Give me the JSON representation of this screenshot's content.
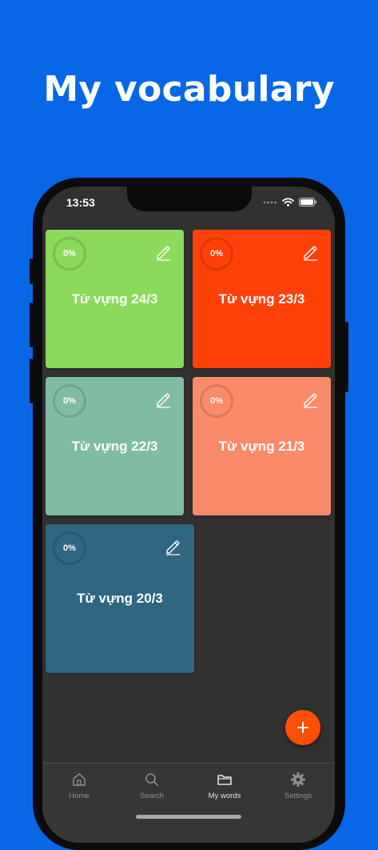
{
  "promo": {
    "title": "My vocabulary"
  },
  "status_bar": {
    "time": "13:53"
  },
  "cards": [
    {
      "title": "Từ vựng 24/3",
      "progress": "0%",
      "color": "#8BDA5C"
    },
    {
      "title": "Từ vựng 23/3",
      "progress": "0%",
      "color": "#FF4109"
    },
    {
      "title": "Từ vựng 22/3",
      "progress": "0%",
      "color": "#80BCA2"
    },
    {
      "title": "Từ vựng 21/3",
      "progress": "0%",
      "color": "#F98A6A"
    },
    {
      "title": "Từ vựng 20/3",
      "progress": "0%",
      "color": "#2F6680"
    }
  ],
  "fab": {
    "icon": "plus-icon",
    "color": "#FF4E06"
  },
  "bottom_nav": {
    "items": [
      {
        "label": "Home",
        "icon": "home-icon",
        "active": false
      },
      {
        "label": "Search",
        "icon": "search-icon",
        "active": false
      },
      {
        "label": "My words",
        "icon": "folder-icon",
        "active": true
      },
      {
        "label": "Settings",
        "icon": "gear-icon",
        "active": false
      }
    ]
  },
  "colors": {
    "background": "#0767E6",
    "screen": "#313131"
  }
}
